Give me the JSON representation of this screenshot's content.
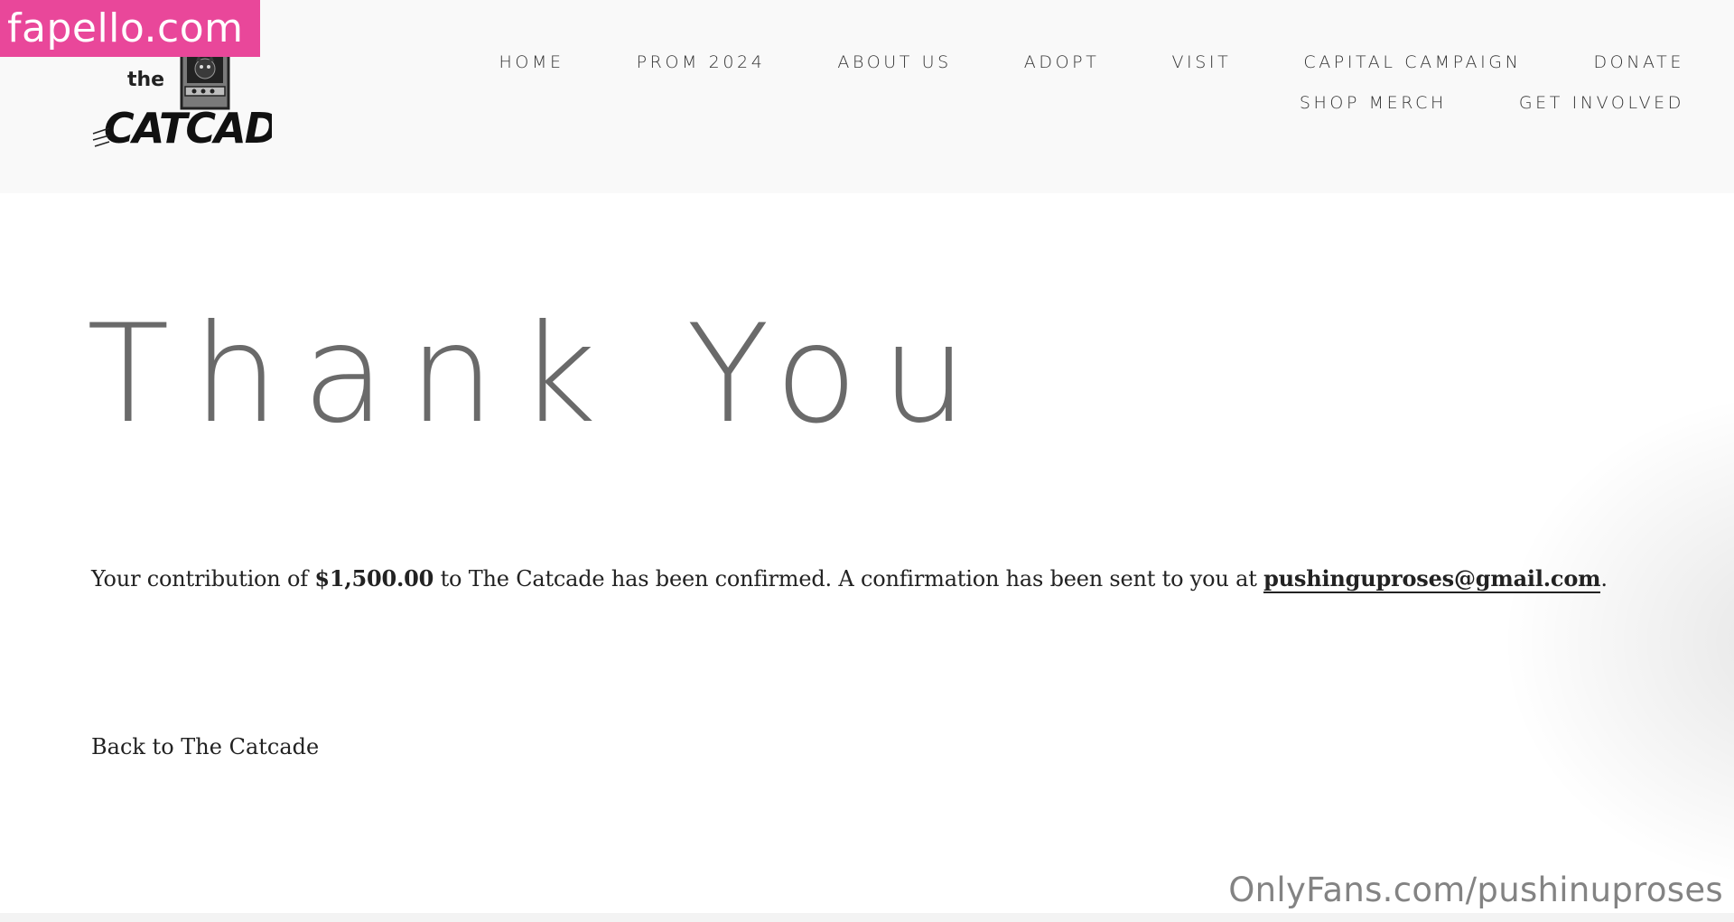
{
  "brand": {
    "logo_small_text": "the",
    "logo_main_text": "CATCADE"
  },
  "nav": {
    "row1": [
      "HOME",
      "PROM 2024",
      "ABOUT US",
      "ADOPT",
      "VISIT",
      "CAPITAL CAMPAIGN",
      "DONATE"
    ],
    "row2": [
      "SHOP MERCH",
      "GET INVOLVED"
    ]
  },
  "main": {
    "title": "Thank You",
    "confirm_prefix": "Your contribution of ",
    "amount": "$1,500.00",
    "confirm_middle": " to The Catcade has been confirmed. A confirmation has been sent to you at ",
    "email": "pushinguproses@gmail.com",
    "confirm_suffix": ".",
    "back_link": "Back to The Catcade"
  },
  "watermarks": {
    "top_left": "fapello.com",
    "bottom_right": "OnlyFans.com/pushinuproses"
  },
  "colors": {
    "header_bg": "#f9f9f9",
    "title_color": "#6a6a6a",
    "watermark_pink": "#e9479a"
  }
}
